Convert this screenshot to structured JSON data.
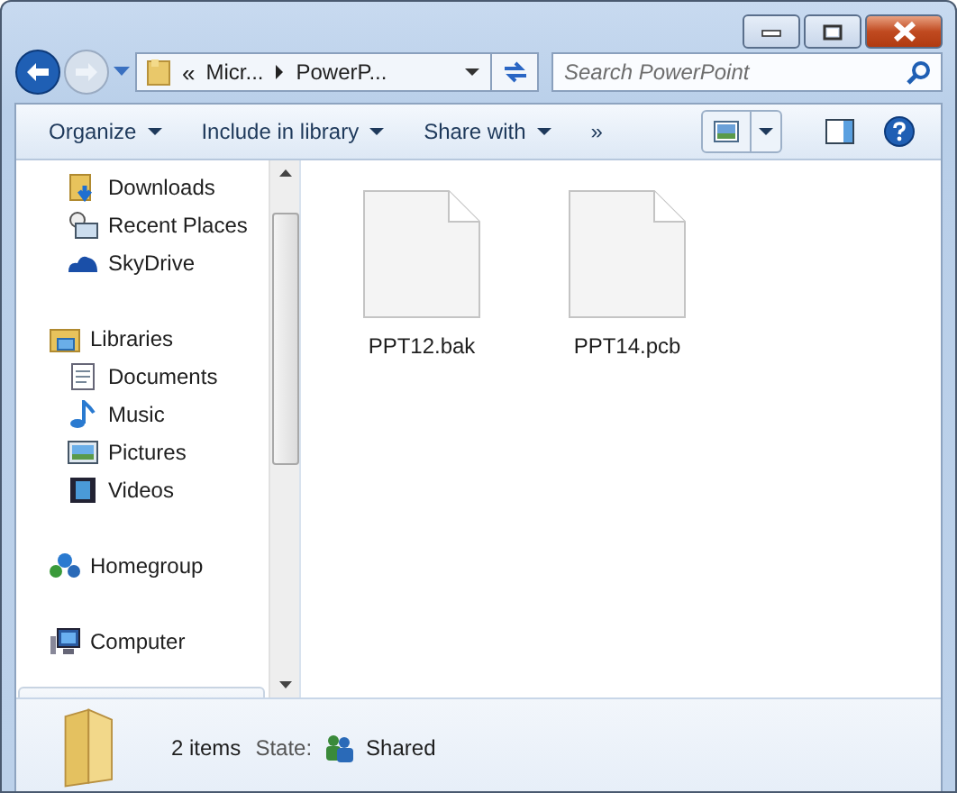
{
  "window": {
    "buttons": [
      {
        "kind": "minimize"
      },
      {
        "kind": "maximize"
      },
      {
        "kind": "close"
      }
    ]
  },
  "address": {
    "overflow": "«",
    "crumbs": [
      "Micr...",
      "PowerP..."
    ]
  },
  "search": {
    "placeholder": "Search PowerPoint"
  },
  "toolbar": {
    "items": [
      {
        "label": "Organize",
        "dropdown": true
      },
      {
        "label": "Include in library",
        "dropdown": true
      },
      {
        "label": "Share with",
        "dropdown": true
      },
      {
        "label": "»",
        "dropdown": false
      }
    ]
  },
  "sidebar": {
    "sections": [
      {
        "items": [
          {
            "label": "Downloads",
            "kind": "downloads"
          },
          {
            "label": "Recent Places",
            "kind": "recent"
          },
          {
            "label": "SkyDrive",
            "kind": "cloud"
          }
        ]
      },
      {
        "header": {
          "label": "Libraries",
          "kind": "library"
        },
        "items": [
          {
            "label": "Documents",
            "kind": "documents"
          },
          {
            "label": "Music",
            "kind": "music"
          },
          {
            "label": "Pictures",
            "kind": "pictures"
          },
          {
            "label": "Videos",
            "kind": "videos"
          }
        ]
      },
      {
        "header": {
          "label": "Homegroup",
          "kind": "homegroup"
        }
      },
      {
        "header": {
          "label": "Computer",
          "kind": "computer"
        }
      }
    ]
  },
  "files": [
    {
      "name": "PPT12.bak"
    },
    {
      "name": "PPT14.pcb"
    }
  ],
  "details": {
    "count": "2 items",
    "state_label": "State:",
    "state": "Shared"
  }
}
